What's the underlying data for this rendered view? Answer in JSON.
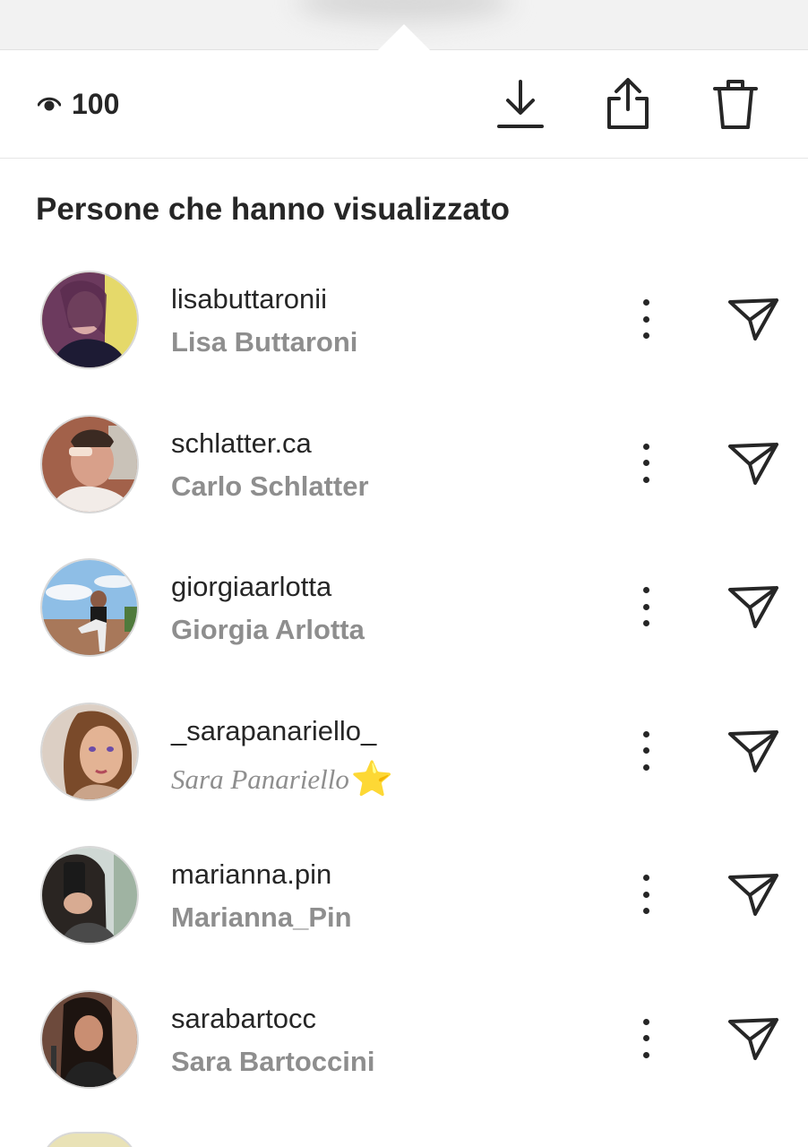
{
  "toolbar": {
    "view_count": "100"
  },
  "section": {
    "title": "Persone che hanno visualizzato"
  },
  "viewers": [
    {
      "username": "lisabuttaronii",
      "full_name": "Lisa Buttaroni"
    },
    {
      "username": "schlatter.ca",
      "full_name": "Carlo Schlatter"
    },
    {
      "username": "giorgiaarlotta",
      "full_name": "Giorgia Arlotta"
    },
    {
      "username": "_sarapanariello_",
      "full_name": "Sara Panariello",
      "full_name_emoji": "⭐"
    },
    {
      "username": "marianna.pin",
      "full_name": "Marianna_Pin"
    },
    {
      "username": "sarabartocc",
      "full_name": "Sara Bartoccini"
    }
  ],
  "icons": {
    "views": "eye-icon",
    "download": "download-icon",
    "share": "share-icon",
    "delete": "trash-icon",
    "more": "more-options-icon",
    "send": "send-icon"
  },
  "colors": {
    "primary_text": "#262626",
    "secondary_text": "#8e8e8e",
    "divider": "#e6e6e6"
  }
}
